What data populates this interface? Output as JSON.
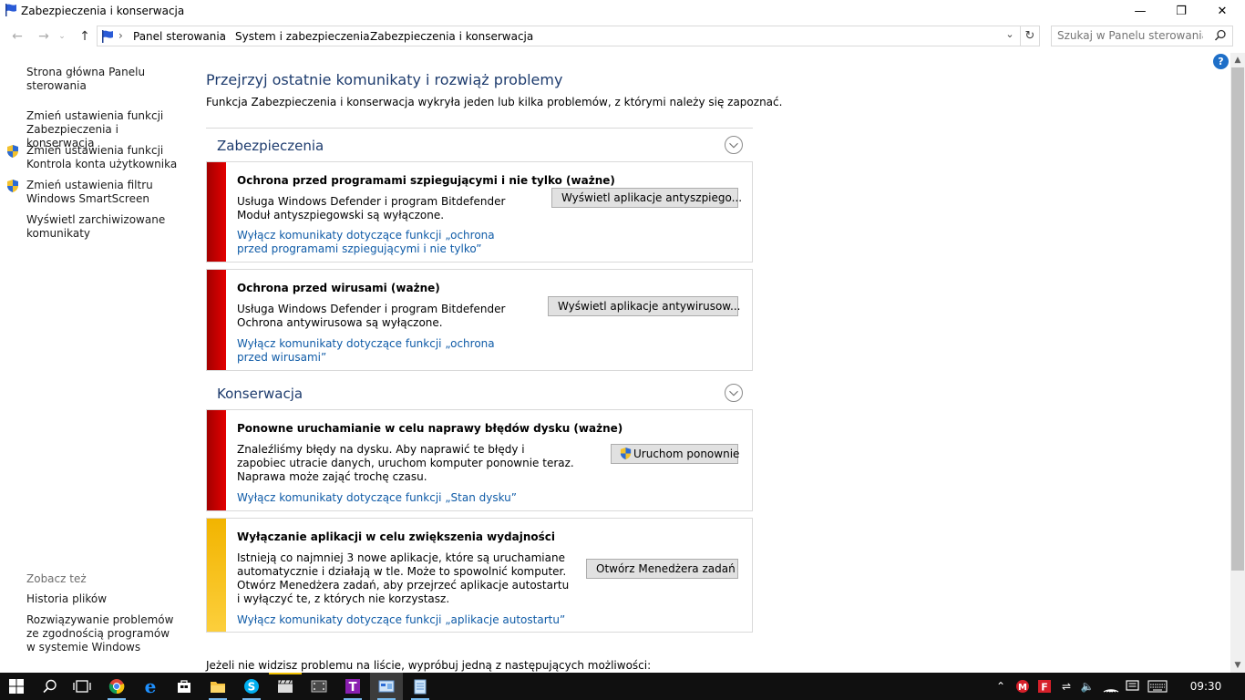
{
  "window": {
    "title": "Zabezpieczenia i konserwacja",
    "minimize_glyph": "—",
    "maximize_glyph": "❐",
    "close_glyph": "✕"
  },
  "address": {
    "crumbs": [
      "Panel sterowania",
      "System i zabezpieczenia",
      "Zabezpieczenia i konserwacja"
    ],
    "separator": "›",
    "search_placeholder": "Szukaj w Panelu sterowania"
  },
  "sidebar": {
    "links": [
      {
        "label": "Strona główna Panelu sterowania",
        "shield": false
      },
      {
        "label": "Zmień ustawienia funkcji Zabezpieczenia i konserwacja",
        "shield": false
      },
      {
        "label": "Zmień ustawienia funkcji Kontrola konta użytkownika",
        "shield": true
      },
      {
        "label": "Zmień ustawienia filtru Windows SmartScreen",
        "shield": true
      },
      {
        "label": "Wyświetl zarchiwizowane komunikaty",
        "shield": false
      }
    ],
    "see_also_title": "Zobacz też",
    "see_also": [
      {
        "label": "Historia plików"
      },
      {
        "label": "Rozwiązywanie problemów ze zgodnością programów w systemie Windows"
      }
    ]
  },
  "main": {
    "title": "Przejrzyj ostatnie komunikaty i rozwiąż problemy",
    "subtitle": "Funkcja Zabezpieczenia i konserwacja wykryła jeden lub kilka problemów, z którymi należy się zapoznać.",
    "sections": [
      {
        "title": "Zabezpieczenia",
        "cards": [
          {
            "title": "Ochrona przed programami szpiegującymi i nie tylko  (ważne)",
            "desc": "Usługa Windows Defender i program Bitdefender Moduł antyszpiegowski są wyłączone.",
            "link": "Wyłącz komunikaty dotyczące funkcji „ochrona przed programami szpiegującymi i nie tylko”",
            "button": "Wyświetl aplikacje antyszpiego...",
            "severity": "red"
          },
          {
            "title": "Ochrona przed wirusami  (ważne)",
            "desc": "Usługa Windows Defender i program Bitdefender Ochrona antywirusowa są wyłączone.",
            "link": "Wyłącz komunikaty dotyczące funkcji „ochrona przed wirusami”",
            "button": "Wyświetl aplikacje antywirusow...",
            "severity": "red"
          }
        ]
      },
      {
        "title": "Konserwacja",
        "cards": [
          {
            "title": "Ponowne uruchamianie w celu naprawy błędów dysku  (ważne)",
            "desc": "Znaleźliśmy błędy na dysku. Aby naprawić te błędy i zapobiec utracie danych, uruchom komputer ponownie teraz. Naprawa może zająć trochę czasu.",
            "link": "Wyłącz komunikaty dotyczące funkcji „Stan dysku”",
            "button": "Uruchom ponownie",
            "severity": "red"
          },
          {
            "title": "Wyłączanie aplikacji w celu zwiększenia wydajności",
            "desc": "Istnieją co najmniej 3 nowe aplikacje, które są uruchamiane automatycznie i działają w tle. Może to spowolnić komputer. Otwórz Menedżera zadań, aby przejrzeć aplikacje autostartu i wyłączyć te, z których nie korzystasz.",
            "link": "Wyłącz komunikaty dotyczące funkcji „aplikacje autostartu”",
            "button": "Otwórz Menedżera zadań",
            "severity": "yellow"
          }
        ]
      }
    ],
    "bottom_text": "Jeżeli nie widzisz problemu na liście, wypróbuj jedną z następujących możliwości:"
  },
  "help_label": "?",
  "taskbar": {
    "clock": "09:30"
  }
}
